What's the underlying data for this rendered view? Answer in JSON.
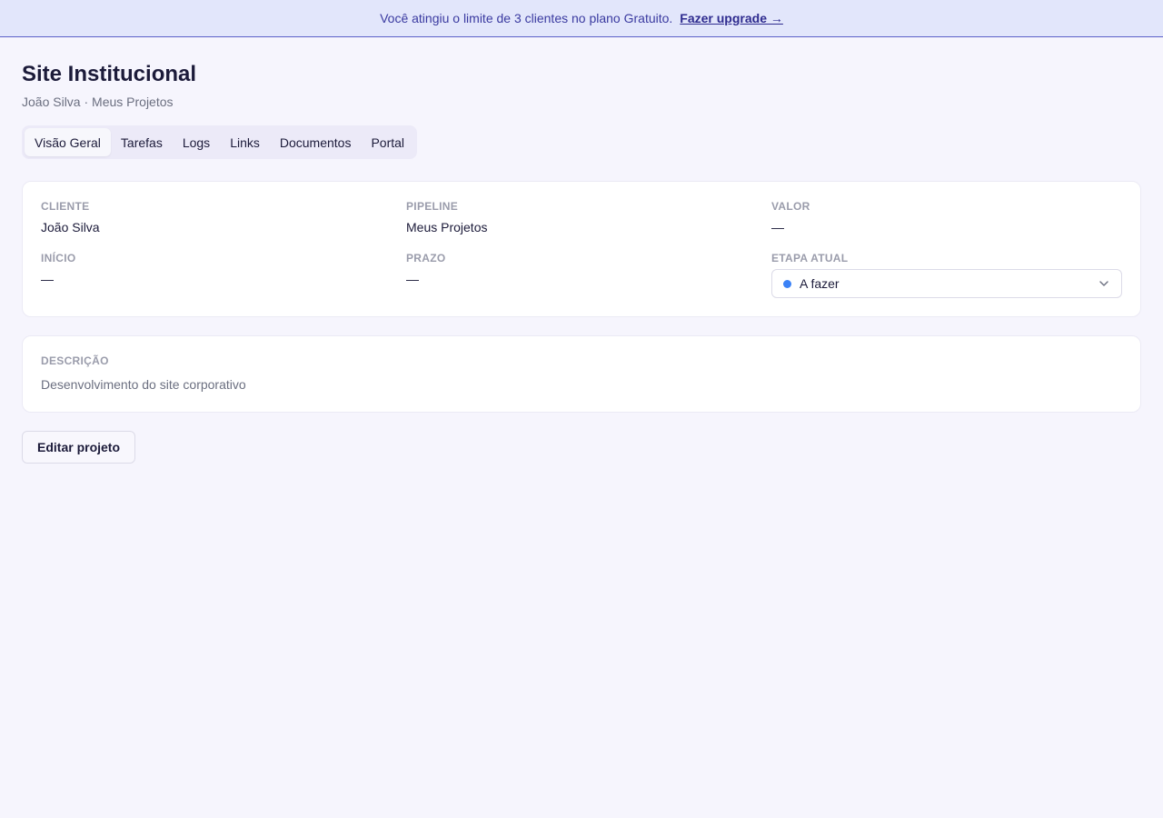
{
  "banner": {
    "message": "Você atingiu o limite de 3 clientes no plano Gratuito.",
    "link": "Fazer upgrade →"
  },
  "project": {
    "title": "Site Institucional",
    "subtitle": "João Silva · Meus Projetos"
  },
  "tabs": [
    {
      "label": "Visão Geral",
      "active": true
    },
    {
      "label": "Tarefas",
      "active": false
    },
    {
      "label": "Logs",
      "active": false
    },
    {
      "label": "Links",
      "active": false
    },
    {
      "label": "Documentos",
      "active": false
    },
    {
      "label": "Portal",
      "active": false
    }
  ],
  "details": {
    "cliente": {
      "label": "Cliente",
      "value": "João Silva"
    },
    "pipeline": {
      "label": "Pipeline",
      "value": "Meus Projetos"
    },
    "valor": {
      "label": "Valor",
      "value": "—"
    },
    "inicio": {
      "label": "Início",
      "value": "—"
    },
    "prazo": {
      "label": "Prazo",
      "value": "—"
    },
    "etapa": {
      "label": "Etapa atual",
      "value": "A fazer",
      "dot_color": "#3b82f6",
      "icon": "chevron-down-icon"
    }
  },
  "description": {
    "label": "Descrição",
    "text": "Desenvolvimento do site corporativo"
  },
  "actions": {
    "edit_label": "Editar projeto"
  }
}
